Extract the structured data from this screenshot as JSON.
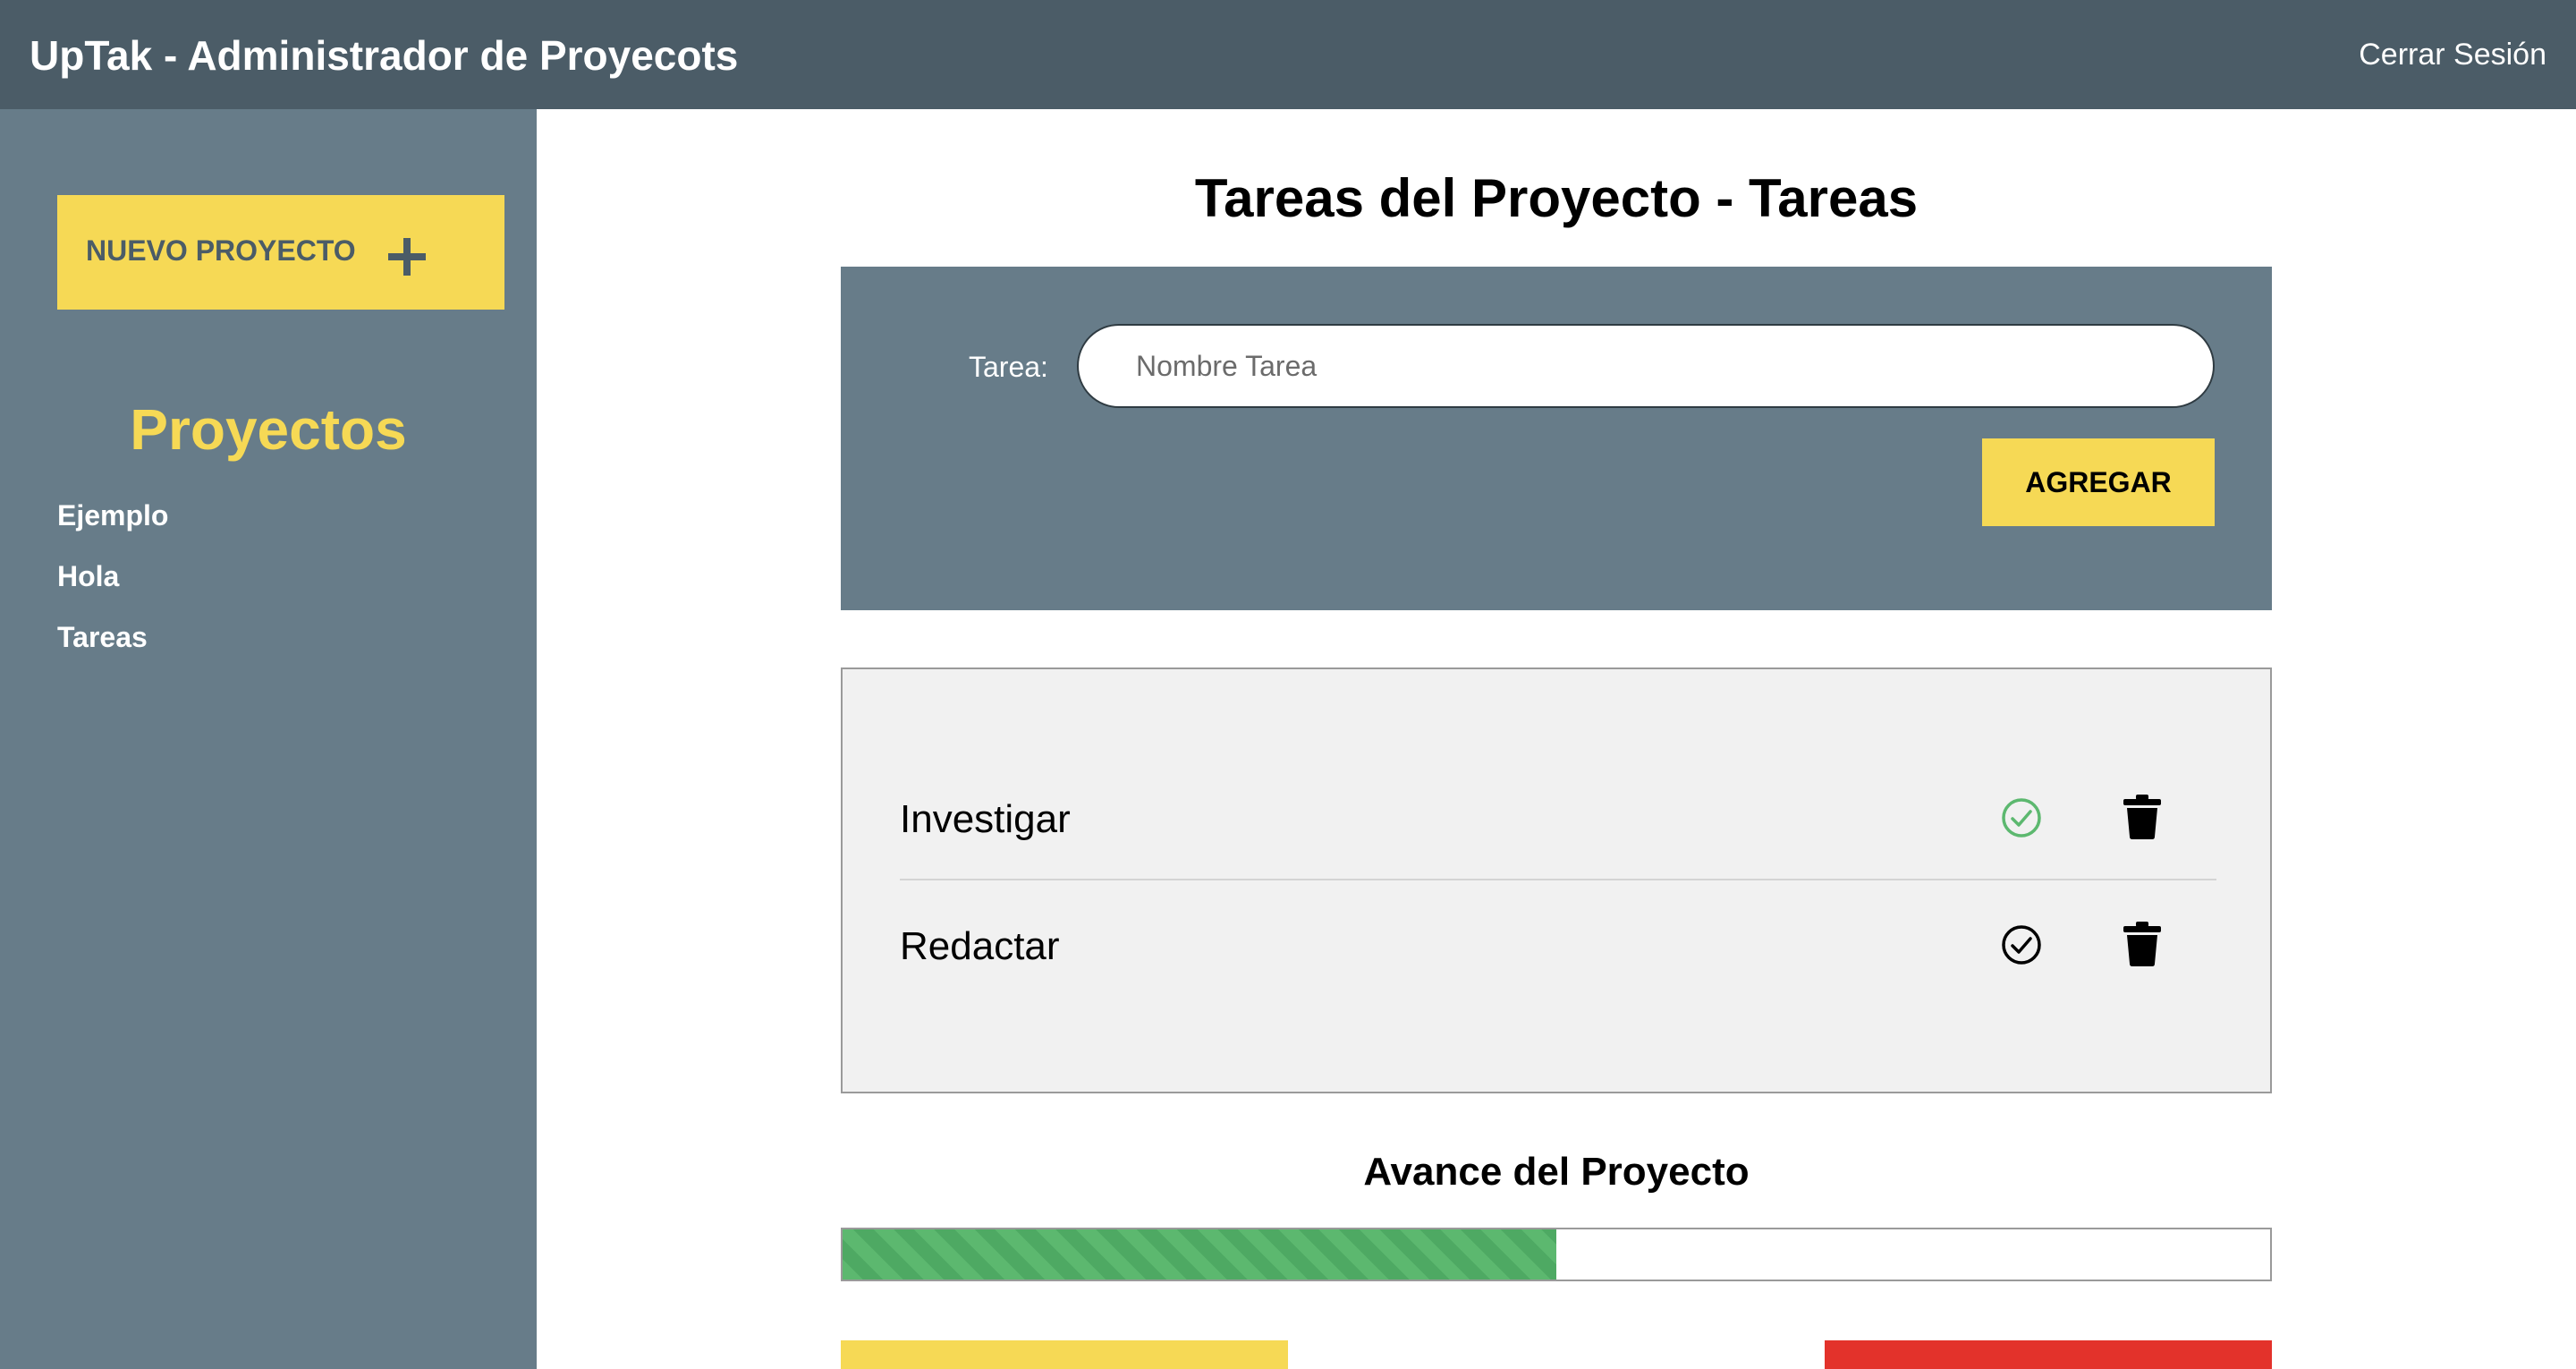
{
  "header": {
    "title": "UpTak - Administrador de Proyecots",
    "logout_label": "Cerrar Sesión"
  },
  "sidebar": {
    "new_project_label": "NUEVO PROYECTO",
    "new_project_icon": "plus-icon",
    "projects_heading": "Proyectos",
    "projects": [
      {
        "label": "Ejemplo"
      },
      {
        "label": "Hola"
      },
      {
        "label": "Tareas"
      }
    ]
  },
  "main": {
    "title": "Tareas del Proyecto - Tareas",
    "form": {
      "task_label": "Tarea:",
      "task_placeholder": "Nombre Tarea",
      "task_value": "",
      "add_button_label": "AGREGAR"
    },
    "tasks": [
      {
        "name": "Investigar",
        "completed": true,
        "check_icon": "check-circle-icon",
        "delete_icon": "trash-icon"
      },
      {
        "name": "Redactar",
        "completed": false,
        "check_icon": "check-circle-icon",
        "delete_icon": "trash-icon"
      }
    ],
    "progress": {
      "title": "Avance del Proyecto",
      "percent": 50
    }
  },
  "colors": {
    "header_bg": "#4b5c67",
    "sidebar_bg": "#677c89",
    "accent_yellow": "#f6d955",
    "completed_green": "#5cb86f",
    "danger_red": "#e3322b"
  }
}
